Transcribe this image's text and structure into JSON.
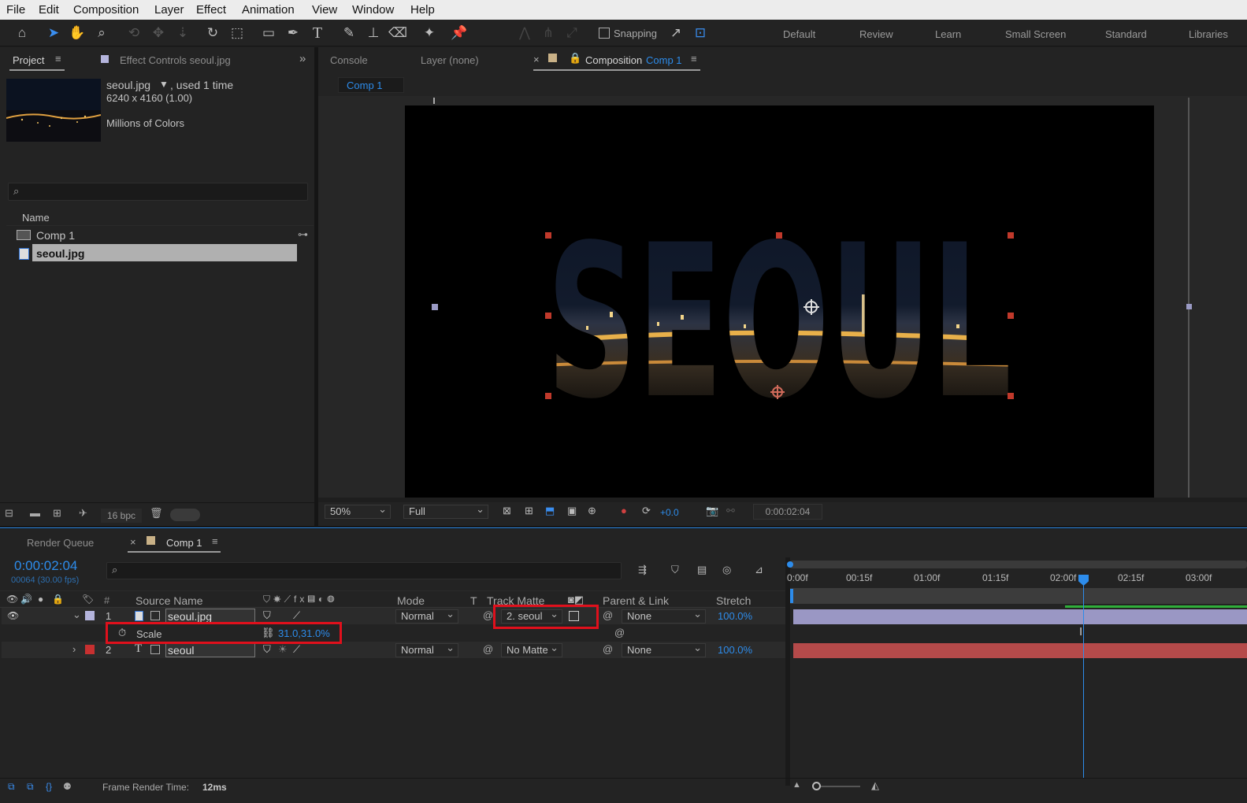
{
  "menu": [
    "File",
    "Edit",
    "Composition",
    "Layer",
    "Effect",
    "Animation",
    "View",
    "Window",
    "Help"
  ],
  "toolbar": {
    "snapping_label": "Snapping",
    "workspaces": [
      "Default",
      "Review",
      "Learn",
      "Small Screen",
      "Standard",
      "Libraries"
    ]
  },
  "project": {
    "tab_label": "Project",
    "effect_controls_label": "Effect Controls seoul.jpg",
    "item_name": "seoul.jpg",
    "usage": ", used 1 time",
    "dimensions": "6240 x 4160 (1.00)",
    "color_info": "Millions of Colors",
    "name_header": "Name",
    "items": [
      {
        "name": "Comp 1",
        "icon": "composition-icon"
      },
      {
        "name": "seoul.jpg",
        "icon": "image-file-icon",
        "selected": true
      }
    ],
    "bpc_label": "16 bpc"
  },
  "viewer": {
    "tabs": [
      "Console",
      "Layer (none)"
    ],
    "comp_tab_prefix": "Composition",
    "comp_tab_name": "Comp 1",
    "breadcrumb": "Comp 1",
    "text": "SEOUL",
    "zoom": "50%",
    "resolution": "Full",
    "exposure": "+0.0",
    "timecode": "0:00:02:04"
  },
  "timeline": {
    "tabs": [
      "Render Queue",
      "Comp 1"
    ],
    "timecode": "0:00:02:04",
    "frame_info": "00064 (30.00 fps)",
    "columns": {
      "hash": "#",
      "source_name": "Source Name",
      "mode": "Mode",
      "t": "T",
      "track_matte": "Track Matte",
      "parent": "Parent & Link",
      "stretch": "Stretch"
    },
    "layers": [
      {
        "num": "1",
        "name": "seoul.jpg",
        "mode": "Normal",
        "matte": "2. seoul",
        "parent": "None",
        "stretch": "100.0%",
        "label_color": "#b4b4dc"
      },
      {
        "num": "2",
        "name": "seoul",
        "mode": "Normal",
        "matte": "No Matte",
        "parent": "None",
        "stretch": "100.0%",
        "label_color": "#c73030"
      }
    ],
    "property": {
      "name": "Scale",
      "value": "31.0,31.0%"
    },
    "ruler": [
      "0:00f",
      "00:15f",
      "01:00f",
      "01:15f",
      "02:00f",
      "02:15f",
      "03:00f"
    ],
    "status_label": "Frame Render Time:",
    "status_value": "12ms"
  },
  "colors": {
    "accent": "#2d8ceb",
    "highlight": "#e0101c",
    "layer1_bar": "#9a97c4",
    "layer2_bar": "#b54a4a",
    "work_area": "#2fae3a"
  }
}
